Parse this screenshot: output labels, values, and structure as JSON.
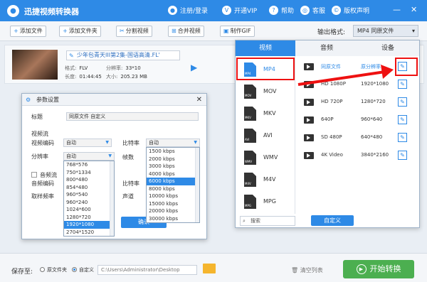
{
  "app": {
    "title": "迅捷视频转换器",
    "logo_char": "●"
  },
  "top_menu": [
    {
      "label": "注册/登录",
      "icon": "user-icon"
    },
    {
      "label": "开通VIP",
      "icon": "vip-icon"
    },
    {
      "label": "帮助",
      "icon": "help-icon"
    },
    {
      "label": "客服",
      "icon": "support-icon"
    },
    {
      "label": "版权声明",
      "icon": "copyright-icon"
    }
  ],
  "window_controls": {
    "minimize": "—",
    "close": "✕"
  },
  "toolbar": {
    "add_file": "添加文件",
    "add_folder": "添加文件夹",
    "split_video": "分割视频",
    "merge_video": "合并视频",
    "make_gif": "制作GIF",
    "output_format_label": "输出格式:",
    "output_format_value": "MP4 同原文件"
  },
  "file": {
    "name": "少年包青天III第2集-国语高清.FL'",
    "format_label": "格式:",
    "format_value": "FLV",
    "res_label": "分辨率:",
    "res_value": "33*10",
    "dur_label": "长度:",
    "dur_value": "01:44:45",
    "size_label": "大小:",
    "size_value": "205.23 MB"
  },
  "dialog": {
    "title": "参数设置",
    "close": "✕",
    "label_title": "标题",
    "title_value": "同原文件 自定义",
    "video_stream": "视频流",
    "video_codec": "视频编码",
    "codec_value": "自动",
    "bitrate": "比特率",
    "bitrate_value": "自动",
    "resolution": "分辨率",
    "res_value": "自动",
    "fps": "帧数",
    "audio_stream": "音频流",
    "audio_codec": "音频编码",
    "sample_rate": "取样频率",
    "bitrate2": "比特率",
    "channel": "声道",
    "ok": "确认",
    "res_options": [
      "768*576",
      "750*1334",
      "800*480",
      "854*480",
      "960*540",
      "960*240",
      "1024*600",
      "1280*720",
      "1920*1080",
      "2704*1520"
    ],
    "res_selected": "1920*1080",
    "bitrate_options": [
      "1500 kbps",
      "2000 kbps",
      "3000 kbps",
      "4000 kbps",
      "6000 kbps",
      "8000 kbps",
      "10000 kbps",
      "15000 kbps",
      "20000 kbps",
      "30000 kbps"
    ],
    "bitrate_selected": "6000 kbps"
  },
  "format_panel": {
    "tabs": [
      "视频",
      "音频",
      "设备"
    ],
    "active_tab": "视频",
    "formats": [
      "MP4",
      "MOV",
      "MKV",
      "AVI",
      "WMV",
      "M4V",
      "MPG"
    ],
    "selected_format": "MP4",
    "presets": [
      {
        "name": "同原文件",
        "res": "原分辨率"
      },
      {
        "name": "HD 1080P",
        "res": "1920*1080"
      },
      {
        "name": "HD 720P",
        "res": "1280*720"
      },
      {
        "name": "640P",
        "res": "960*640"
      },
      {
        "name": "SD 480P",
        "res": "640*480"
      },
      {
        "name": "4K Video",
        "res": "3840*2160"
      }
    ],
    "search": "搜索",
    "custom": "自定义"
  },
  "bottom": {
    "save_to": "保存至:",
    "opt_source": "原文件夹",
    "opt_custom": "自定义",
    "path": "C:\\Users\\Administrator\\Desktop",
    "clear_list": "清空列表",
    "start": "开始转换"
  },
  "colors": {
    "accent": "#2e8ae6",
    "highlight": "#e11111",
    "start": "#4caf50"
  }
}
